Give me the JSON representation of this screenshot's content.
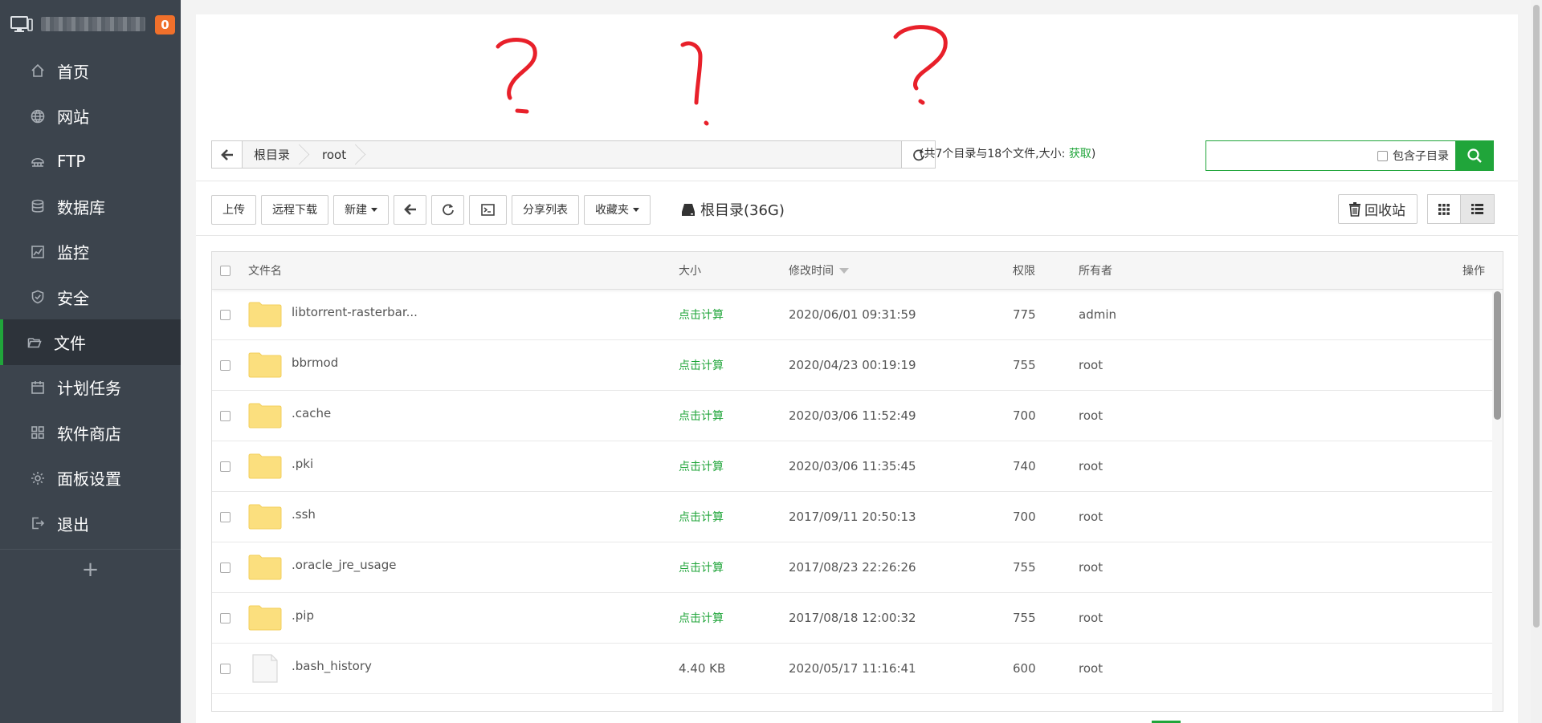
{
  "sidebar": {
    "notification_count": "0",
    "menu": [
      {
        "label": "首页",
        "icon": "home-icon"
      },
      {
        "label": "网站",
        "icon": "globe-icon"
      },
      {
        "label": "FTP",
        "icon": "ftp-icon"
      },
      {
        "label": "数据库",
        "icon": "database-icon"
      },
      {
        "label": "监控",
        "icon": "monitor-chart-icon"
      },
      {
        "label": "安全",
        "icon": "shield-icon"
      },
      {
        "label": "文件",
        "icon": "folder-open-icon",
        "active": true
      },
      {
        "label": "计划任务",
        "icon": "calendar-icon"
      },
      {
        "label": "软件商店",
        "icon": "apps-grid-icon"
      },
      {
        "label": "面板设置",
        "icon": "gear-icon"
      },
      {
        "label": "退出",
        "icon": "logout-icon"
      }
    ],
    "add_label": "+"
  },
  "address": {
    "crumbs": [
      "根目录",
      "root"
    ],
    "summary_prefix": "(共7个目录与18个文件,大小: ",
    "summary_link": "获取",
    "summary_suffix": ")"
  },
  "search": {
    "value": "",
    "subdir_label": "包含子目录"
  },
  "toolbar": {
    "upload": "上传",
    "remote_download": "远程下载",
    "new": "新建",
    "share_list": "分享列表",
    "favorites": "收藏夹",
    "disk_label": "根目录(36G)",
    "recycle_bin": "回收站"
  },
  "table": {
    "headers": {
      "name": "文件名",
      "size": "大小",
      "mtime": "修改时间",
      "perm": "权限",
      "owner": "所有者",
      "op": "操作"
    },
    "rows": [
      {
        "type": "folder",
        "name": "libtorrent-rasterbar...",
        "size": "点击计算",
        "mtime": "2020/06/01 09:31:59",
        "perm": "775",
        "owner": "admin"
      },
      {
        "type": "folder",
        "name": "bbrmod",
        "size": "点击计算",
        "mtime": "2020/04/23 00:19:19",
        "perm": "755",
        "owner": "root"
      },
      {
        "type": "folder",
        "name": ".cache",
        "size": "点击计算",
        "mtime": "2020/03/06 11:52:49",
        "perm": "700",
        "owner": "root"
      },
      {
        "type": "folder",
        "name": ".pki",
        "size": "点击计算",
        "mtime": "2020/03/06 11:35:45",
        "perm": "740",
        "owner": "root"
      },
      {
        "type": "folder",
        "name": ".ssh",
        "size": "点击计算",
        "mtime": "2017/09/11 20:50:13",
        "perm": "700",
        "owner": "root"
      },
      {
        "type": "folder",
        "name": ".oracle_jre_usage",
        "size": "点击计算",
        "mtime": "2017/08/23 22:26:26",
        "perm": "755",
        "owner": "root"
      },
      {
        "type": "folder",
        "name": ".pip",
        "size": "点击计算",
        "mtime": "2017/08/18 12:00:32",
        "perm": "755",
        "owner": "root"
      },
      {
        "type": "file",
        "name": ".bash_history",
        "size": "4.40 KB",
        "mtime": "2020/05/17 11:16:41",
        "perm": "600",
        "owner": "root"
      }
    ]
  },
  "colors": {
    "accent": "#20a53a",
    "sidebar_bg": "#3c444d",
    "badge": "#f0702b",
    "annotation": "#e8202a",
    "folder": "#fbdf7e"
  }
}
